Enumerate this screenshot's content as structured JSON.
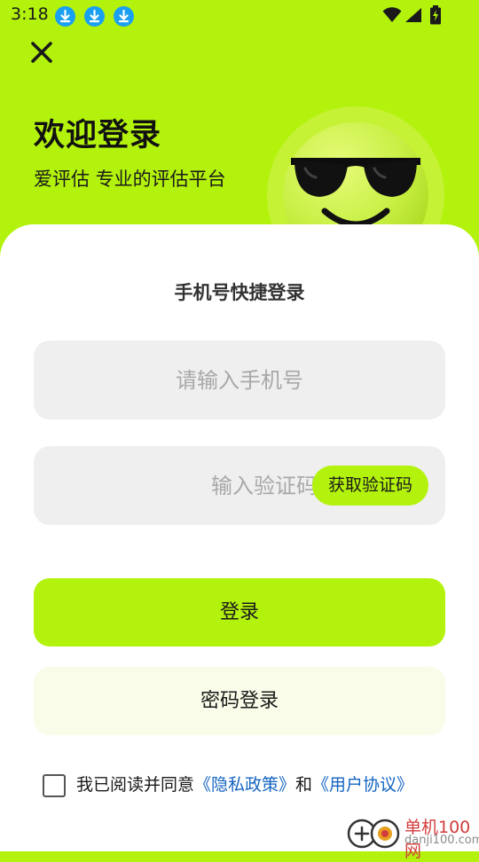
{
  "status_bar": {
    "time": "3:18",
    "notifications": [
      "download-icon",
      "download-icon",
      "download-icon"
    ]
  },
  "header": {
    "close_icon": "close-icon",
    "title": "欢迎登录",
    "subtitle": "爱评估 专业的评估平台"
  },
  "login_card": {
    "title": "手机号快捷登录",
    "phone": {
      "value": "",
      "placeholder": "请输入手机号"
    },
    "code": {
      "value": "",
      "placeholder": "输入验证码",
      "get_code_label": "获取验证码"
    },
    "login_label": "登录",
    "password_login_label": "密码登录",
    "agreement": {
      "checked": false,
      "prefix": "我已阅读并同意",
      "privacy_link": "《隐私政策》",
      "conjunction": "和",
      "terms_link": "《用户协议》"
    }
  },
  "watermark": {
    "site_cn": "单机100网",
    "site_en": "danji100.com"
  },
  "colors": {
    "accent": "#b3f20d",
    "card": "#ffffff",
    "field_bg": "#efefef",
    "secondary_button": "#f8fce8",
    "link": "#1565c0"
  }
}
